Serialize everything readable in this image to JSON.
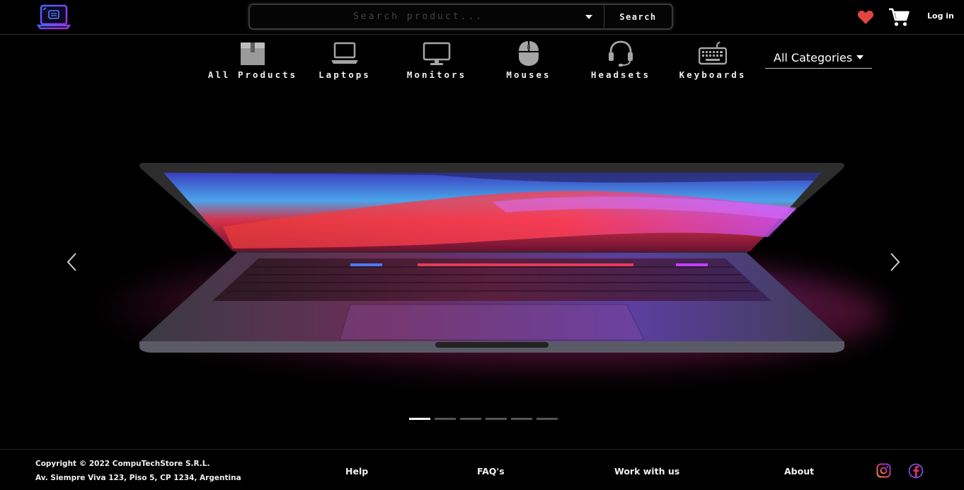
{
  "header": {
    "search_placeholder": "Search product...",
    "search_button": "Search",
    "login": "Log in"
  },
  "categories": {
    "items": [
      {
        "label": "All Products",
        "icon": "box-icon"
      },
      {
        "label": "Laptops",
        "icon": "laptop-icon"
      },
      {
        "label": "Monitors",
        "icon": "monitor-icon"
      },
      {
        "label": "Mouses",
        "icon": "mouse-icon"
      },
      {
        "label": "Headsets",
        "icon": "headset-icon"
      },
      {
        "label": "Keyboards",
        "icon": "keyboard-icon"
      }
    ],
    "select_value": "All Categories"
  },
  "carousel": {
    "slide_count": 6,
    "active_index": 0
  },
  "footer": {
    "copyright": "Copyright © 2022 CompuTechStore S.R.L.",
    "address": "Av. Siempre Viva 123, Piso 5, CP 1234, Argentina",
    "links": [
      "Help",
      "FAQ's",
      "Work with us",
      "About"
    ]
  },
  "colors": {
    "accent_purple": "#7b2cd6",
    "heart_red": "#e0453f",
    "background": "#000000"
  }
}
